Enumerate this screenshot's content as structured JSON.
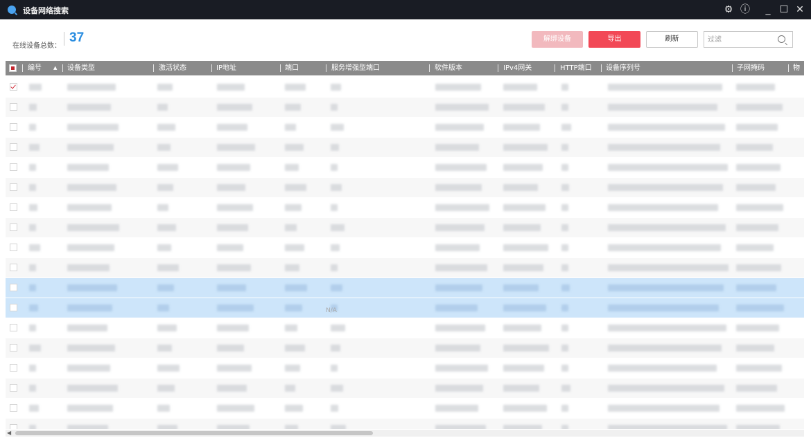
{
  "window": {
    "title": "设备网络搜索"
  },
  "toolbar": {
    "total_label": "在线设备总数：",
    "total_count": "37",
    "unbind_label": "解绑设备",
    "export_label": "导出",
    "refresh_label": "刷新",
    "filter_placeholder": "过滤"
  },
  "table": {
    "columns": [
      "编号",
      "设备类型",
      "激活状态",
      "IP地址",
      "端口",
      "服务增强型端口",
      "软件版本",
      "IPv4网关",
      "HTTP端口",
      "设备序列号",
      "子网掩码",
      "物"
    ],
    "visible_cell_text": "N/A",
    "rows_visible": 18,
    "selected_rows": [
      10,
      11
    ],
    "checked_row": 0
  },
  "colors": {
    "titlebar": "#191c24",
    "accent_blue": "#2a8de0",
    "export_red": "#f24856",
    "header_gray": "#8a8a8a",
    "selected_row": "#cde5fa"
  }
}
